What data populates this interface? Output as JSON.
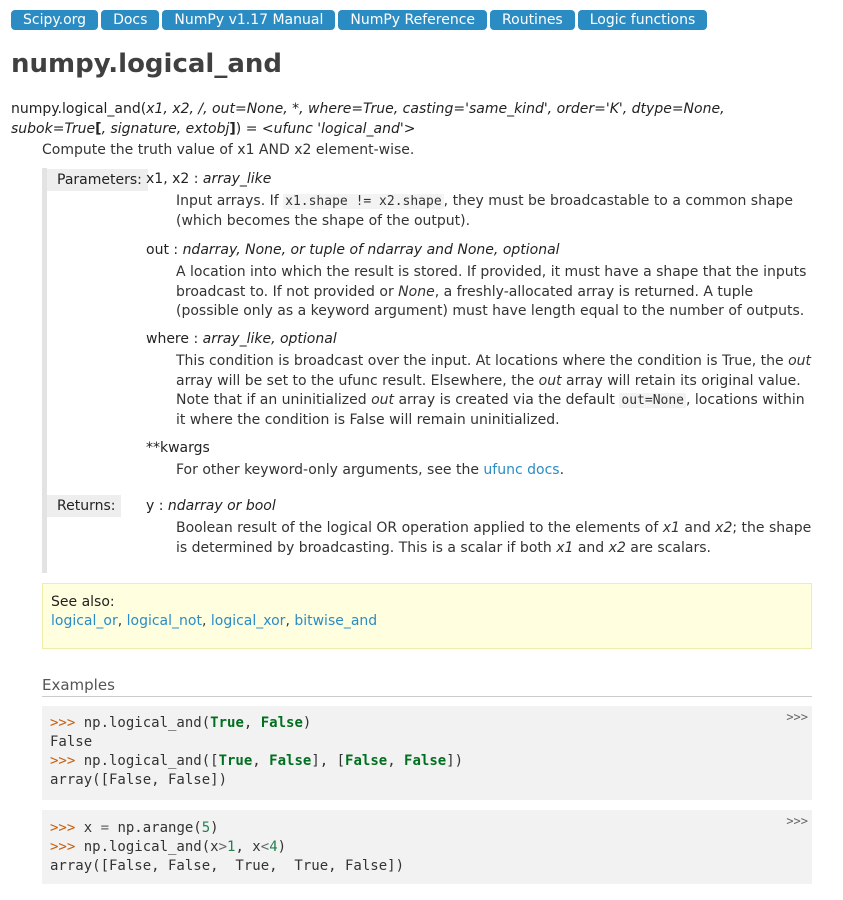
{
  "breadcrumbs": [
    "Scipy.org",
    "Docs",
    "NumPy v1.17 Manual",
    "NumPy Reference",
    "Routines",
    "Logic functions"
  ],
  "title": "numpy.logical_and",
  "signature": {
    "prefix": "numpy.",
    "name": "logical_and",
    "open": "(",
    "args": "x1, x2, /, out=None, *, where=True, casting='same_kind', order='K', dtype=None, subok=True",
    "bracket_open": "[",
    "args2_start": ", ",
    "args2": "signature, extobj",
    "bracket_close": "]",
    "close": ") = ",
    "ret": "<ufunc 'logical_and'>"
  },
  "summary": "Compute the truth value of x1 AND x2 element-wise.",
  "parameters_label": "Parameters:",
  "returns_label": "Returns:",
  "params": {
    "x": {
      "name": "x1, x2",
      "sep": " : ",
      "type": "array_like",
      "d1": "Input arrays. If ",
      "code1": "x1.shape != x2.shape",
      "d2": ", they must be broadcastable to a common shape (which becomes the shape of the output)."
    },
    "out": {
      "name": "out",
      "sep": " : ",
      "type": "ndarray, None, or tuple of ndarray and None, optional",
      "d1": "A location into which the result is stored. If provided, it must have a shape that the inputs broadcast to. If not provided or ",
      "i1": "None",
      "d2": ", a freshly-allocated array is returned. A tuple (possible only as a keyword argument) must have length equal to the number of outputs."
    },
    "where": {
      "name": "where",
      "sep": " : ",
      "type": "array_like, optional",
      "d1": "This condition is broadcast over the input. At locations where the condition is True, the ",
      "i1": "out",
      "d2": " array will be set to the ufunc result. Elsewhere, the ",
      "i2": "out",
      "d3": " array will retain its original value. Note that if an uninitialized ",
      "i3": "out",
      "d4": " array is created via the default ",
      "code1": "out=None",
      "d5": ", locations within it where the condition is False will remain uninitialized."
    },
    "kwargs": {
      "name": "**kwargs",
      "d1": "For other keyword-only arguments, see the ",
      "link": "ufunc docs",
      "d2": "."
    }
  },
  "returns": {
    "name": "y",
    "sep": " : ",
    "type": "ndarray or bool",
    "d1": "Boolean result of the logical OR operation applied to the elements of ",
    "i1": "x1",
    "d2": " and ",
    "i2": "x2",
    "d3": "; the shape is determined by broadcasting. This is a scalar if both ",
    "i3": "x1",
    "d4": " and ",
    "i4": "x2",
    "d5": " are scalars."
  },
  "see_also": {
    "label": "See also:",
    "links": [
      "logical_or",
      "logical_not",
      "logical_xor",
      "bitwise_and"
    ],
    "sep": ", "
  },
  "examples_heading": "Examples",
  "copy_label": ">>>",
  "code": {
    "prompt": ">>> ",
    "b1": {
      "l1_a": "np.logical_and(",
      "l1_kw1": "True",
      "l1_b": ", ",
      "l1_kw2": "False",
      "l1_c": ")",
      "l2": "False",
      "l3_a": "np.logical_and([",
      "l3_kw1": "True",
      "l3_b": ", ",
      "l3_kw2": "False",
      "l3_c": "], [",
      "l3_kw3": "False",
      "l3_d": ", ",
      "l3_kw4": "False",
      "l3_e": "])",
      "l4": "array([False, False])"
    },
    "b2": {
      "l1_a": "x ",
      "l1_op": "=",
      "l1_b": " np.arange(",
      "l1_num": "5",
      "l1_c": ")",
      "l2_a": "np.logical_and(x",
      "l2_op1": ">",
      "l2_num1": "1",
      "l2_b": ", x",
      "l2_op2": "<",
      "l2_num2": "4",
      "l2_c": ")",
      "l3": "array([False, False,  True,  True, False])"
    }
  }
}
